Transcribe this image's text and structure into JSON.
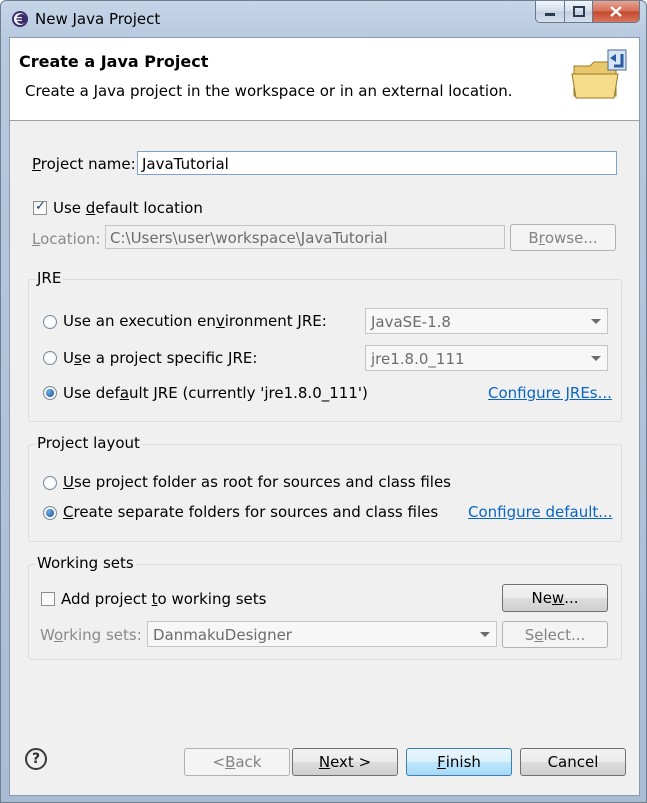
{
  "window": {
    "title": "New Java Project"
  },
  "banner": {
    "title": "Create a Java Project",
    "description": "Create a Java project in the workspace or in an external location."
  },
  "project": {
    "name_label_mnemonic": "P",
    "name_label_rest": "roject name:",
    "name_value": "JavaTutorial",
    "use_default_pre": "Use ",
    "use_default_mnemonic": "d",
    "use_default_post": "efault location",
    "use_default_checked": true,
    "location_mnemonic": "L",
    "location_rest": "ocation:",
    "location_value": "C:\\Users\\user\\workspace\\JavaTutorial",
    "browse_pre": "B",
    "browse_mnemonic": "r",
    "browse_post": "owse..."
  },
  "jre": {
    "title": "JRE",
    "opt1_pre": "Use an execution en",
    "opt1_mnemonic": "v",
    "opt1_post": "ironment JRE:",
    "opt1_value": "JavaSE-1.8",
    "opt2_pre": "U",
    "opt2_mnemonic": "s",
    "opt2_post": "e a project specific JRE:",
    "opt2_value": "jre1.8.0_111",
    "opt3_pre": "Use def",
    "opt3_mnemonic": "a",
    "opt3_post": "ult JRE (currently 'jre1.8.0_111')",
    "selected": 3,
    "configure_link": "Configure JREs..."
  },
  "layout": {
    "title": "Project layout",
    "opt1_mnemonic": "U",
    "opt1_post": "se project folder as root for sources and class files",
    "opt2_mnemonic": "C",
    "opt2_post": "reate separate folders for sources and class files",
    "selected": 2,
    "configure_link": "Configure default..."
  },
  "working_sets": {
    "title": "Working sets",
    "add_pre": "Add project ",
    "add_mnemonic": "t",
    "add_post": "o working sets",
    "add_checked": false,
    "new_pre": "Ne",
    "new_mnemonic": "w",
    "new_post": "...",
    "label_pre": "W",
    "label_mnemonic": "o",
    "label_post": "rking sets:",
    "value": "DanmakuDesigner",
    "select_pre": "S",
    "select_mnemonic": "e",
    "select_post": "lect..."
  },
  "footer": {
    "help_glyph": "?",
    "back_pre": "< ",
    "back_mnemonic": "B",
    "back_post": "ack",
    "next_mnemonic": "N",
    "next_post": "ext >",
    "finish_mnemonic": "F",
    "finish_post": "inish",
    "cancel_label": "Cancel"
  }
}
